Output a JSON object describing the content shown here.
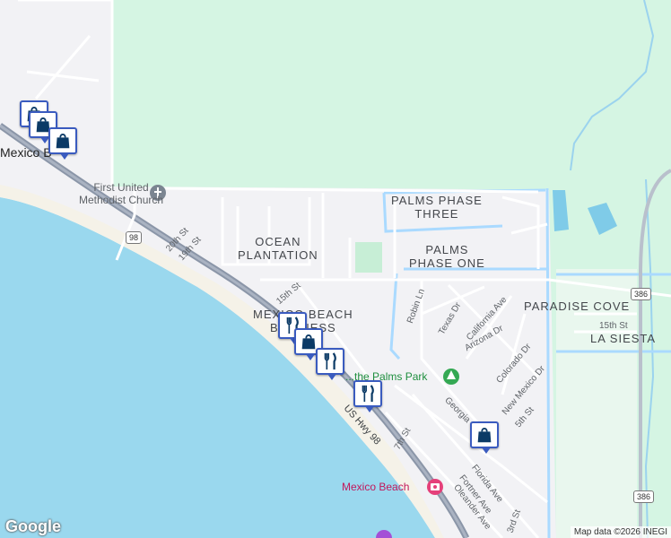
{
  "labels": {
    "town_top_left": "Mexico B",
    "church": "First United Methodist Church",
    "church_line1": "First United",
    "church_line2": "Methodist Church",
    "palms_three_1": "PALMS PHASE",
    "palms_three_2": "THREE",
    "palms_one_1": "PALMS",
    "palms_one_2": "PHASE ONE",
    "ocean_plantation_1": "OCEAN",
    "ocean_plantation_2": "PLANTATION",
    "mexico_beach_business_1": "MEXICO BEACH",
    "mexico_beach_business_2": "BUSINESS",
    "paradise_cove": "PARADISE COVE",
    "la_siesta": "LA SIESTA",
    "park": "...the Palms Park",
    "mexico_beach_poi": "Mexico Beach"
  },
  "streets": {
    "s20th": "20th St",
    "s19th": "19th St",
    "s15th_west": "15th St",
    "s15th_east": "15th St",
    "robin": "Robin Ln",
    "texas": "Texas Dr",
    "california": "California Ave",
    "arizona": "Arizona Dr",
    "colorado": "Colorado Dr",
    "new_mexico": "New Mexico Dr",
    "georgia": "Georgia",
    "s5th": "5th St",
    "s7th": "7th St",
    "us98": "US Hwy 98",
    "florida": "Florida Ave",
    "fortner": "Fortner Ave",
    "oleander": "Oleander Ave",
    "s3rd": "3rd St"
  },
  "route_shields": {
    "r98": "98",
    "r386_top": "386",
    "r386_bottom": "386"
  },
  "markers": [
    {
      "type": "shopping",
      "icon": "shopping-bag-icon"
    },
    {
      "type": "shopping",
      "icon": "shopping-bag-icon"
    },
    {
      "type": "restaurant",
      "icon": "fork-knife-icon"
    },
    {
      "type": "shopping",
      "icon": "shopping-bag-icon"
    },
    {
      "type": "restaurant",
      "icon": "fork-knife-icon"
    },
    {
      "type": "restaurant",
      "icon": "fork-knife-icon"
    },
    {
      "type": "shopping",
      "icon": "shopping-bag-icon"
    }
  ],
  "footer": {
    "logo": "Google",
    "attribution": "Map data ©2026 INEGI"
  },
  "colors": {
    "water": "#9ad8ee",
    "land": "#f2f2f5",
    "park_green": "#d5f5e3",
    "highway": "#8b96a8",
    "canal": "#aadaff",
    "marker_blue": "#3a5bbf"
  }
}
